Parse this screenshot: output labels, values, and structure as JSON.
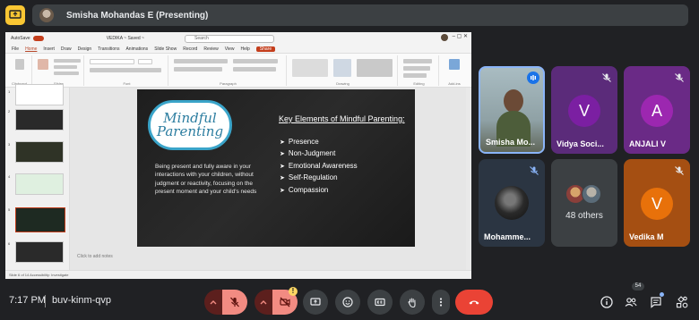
{
  "presenter": {
    "label": "Smisha Mohandas E (Presenting)"
  },
  "powerpoint": {
    "autosave": "AutoSave",
    "file_name": "VEDIKA ~ Saved ~",
    "search_placeholder": "Search",
    "menu": [
      "File",
      "Home",
      "Insert",
      "Draw",
      "Design",
      "Transitions",
      "Animations",
      "Slide Show",
      "Record",
      "Review",
      "View",
      "Help"
    ],
    "share_label": "Share",
    "ribbon_groups": [
      "Clipboard",
      "Slides",
      "Font",
      "Paragraph",
      "Drawing",
      "Editing",
      "Add-ins"
    ],
    "notes_placeholder": "Click to add notes",
    "status_text": "Slide 6 of 14   Accessibility: Investigate",
    "slide_numbers": [
      "1",
      "2",
      "3",
      "4",
      "5",
      "6"
    ]
  },
  "slide": {
    "logo_line1": "Mindful",
    "logo_line2": "Parenting",
    "body": "Being present and fully aware in your interactions with your children, without judgment or reactivity, focusing on the present moment and your child's needs",
    "heading": "Key Elements of Mindful Parenting:",
    "items": [
      "Presence",
      "Non-Judgment",
      "Emotional Awareness",
      "Self-Regulation",
      "Compassion"
    ]
  },
  "participants": [
    {
      "name": "Smisha Mo...",
      "type": "video",
      "speaking": true
    },
    {
      "name": "Vidya Soci...",
      "letter": "V",
      "color": "#7b1fa2",
      "bg": "#6a1b9a",
      "muted": true
    },
    {
      "name": "ANJALI V",
      "letter": "A",
      "color": "#9c27b0",
      "bg": "#7b1fa2",
      "muted": true
    },
    {
      "name": "Mohamme...",
      "type": "photo",
      "muted": true
    },
    {
      "name": "48 others",
      "type": "others"
    },
    {
      "name": "Vedika M",
      "letter": "V",
      "color": "#e65100",
      "bg": "#bf5a10",
      "muted": true
    }
  ],
  "bottom": {
    "time": "7:17 PM",
    "meeting_code": "buv-kinm-qvp",
    "people_count": "54"
  },
  "colors": {
    "meet_yellow": "#f9c633",
    "end_call_red": "#ea4335",
    "muted_red": "#f28b82"
  }
}
